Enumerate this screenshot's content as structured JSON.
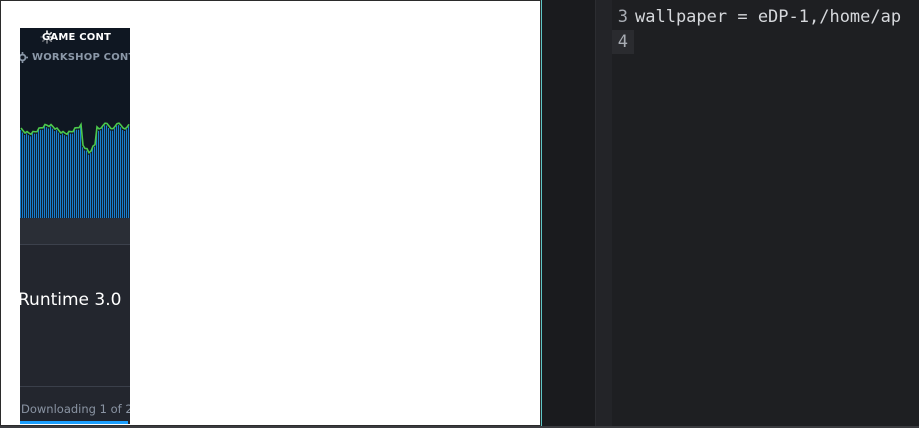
{
  "steam": {
    "tab_game_content": "GAME CONT",
    "tab_workshop_content": "WORKSHOP CONT",
    "item_title": "Runtime 3.0",
    "footer_status": "Downloading 1 of 2",
    "graph_color": "#4cc94c",
    "bar_color": "#1a7fcc",
    "progress_fraction": 0.98
  },
  "editor": {
    "lines": [
      {
        "number": "3",
        "text": "wallpaper = eDP-1,/home/ap"
      },
      {
        "number": "4",
        "text": ""
      }
    ]
  }
}
